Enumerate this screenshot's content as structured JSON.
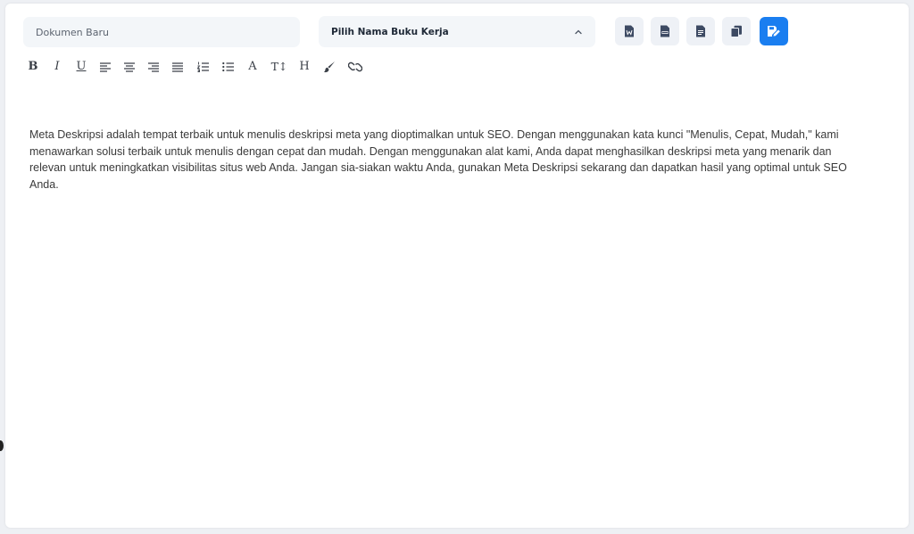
{
  "document": {
    "name_placeholder": "Dokumen Baru"
  },
  "workbook": {
    "selected_label": "Pilih Nama Buku Kerja"
  },
  "actions": [
    {
      "name": "export-word-button",
      "icon": "word-file-icon",
      "glyph": "W"
    },
    {
      "name": "export-pdf-button",
      "icon": "pdf-file-icon",
      "glyph": "PDF"
    },
    {
      "name": "export-text-button",
      "icon": "text-file-icon",
      "glyph": "≡"
    },
    {
      "name": "copy-button",
      "icon": "copy-icon",
      "glyph": ""
    },
    {
      "name": "save-button",
      "icon": "save-edit-icon",
      "glyph": "",
      "primary": true
    }
  ],
  "toolbar": {
    "bold": "B",
    "italic": "I",
    "underline": "U",
    "font_color": "A",
    "text_size": "T↕",
    "heading": "H"
  },
  "editor": {
    "content": "Meta Deskripsi adalah tempat terbaik untuk menulis deskripsi meta yang dioptimalkan untuk SEO. Dengan menggunakan kata kunci \"Menulis, Cepat, Mudah,\" kami menawarkan solusi terbaik untuk menulis dengan cepat dan mudah. Dengan menggunakan alat kami, Anda dapat menghasilkan deskripsi meta yang menarik dan relevan untuk meningkatkan visibilitas situs web Anda. Jangan sia-siakan waktu Anda, gunakan Meta Deskripsi sekarang dan dapatkan hasil yang optimal untuk SEO Anda."
  },
  "colors": {
    "accent": "#1a7ef0",
    "field_bg": "#f3f6f9",
    "icon_button_bg": "#eef1f6",
    "icon_color": "#3d4a63",
    "text": "#3a3a3a"
  }
}
